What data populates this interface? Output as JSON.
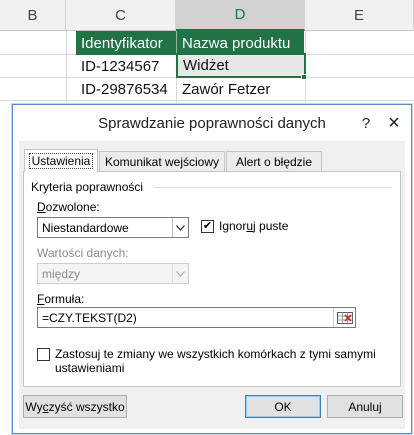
{
  "sheet": {
    "columns": [
      "B",
      "C",
      "D",
      "E"
    ],
    "selected_column": "D",
    "header_row": [
      "Identyfikator",
      "Nazwa produktu"
    ],
    "rows": [
      [
        "ID-1234567",
        "Widżet"
      ],
      [
        "ID-29876534",
        "Zawór Fetzer"
      ]
    ]
  },
  "dialog": {
    "title": "Sprawdzanie poprawności danych",
    "help_label": "?",
    "close_label": "×",
    "tabs": [
      "Ustawienia",
      "Komunikat wejściowy",
      "Alert o błędzie"
    ],
    "active_tab": "Ustawienia",
    "criteria_group": "Kryteria poprawności",
    "allow_label_pre": "",
    "allow_label_u": "D",
    "allow_label_post": "ozwolone:",
    "allow_value": "Niestandardowe",
    "ignore_blank_checked": "✔",
    "ignore_blank_pre": "Ignor",
    "ignore_blank_u": "u",
    "ignore_blank_post": "j puste",
    "data_label": "Wartości danych:",
    "data_value": "między",
    "formula_label_pre": "",
    "formula_label_u": "F",
    "formula_label_post": "ormuła:",
    "formula_value": "=CZY.TEKST(D2)",
    "apply_all_label": "Zastosuj te zmiany we wszystkich komórkach z tymi samymi ustawieniami",
    "clear_all_label_pre": "Wy",
    "clear_all_label_u": "c",
    "clear_all_label_post": "zyść wszystko",
    "ok_label": "OK",
    "cancel_label": "Anuluj"
  },
  "colors": {
    "excel_green": "#217346",
    "dialog_border": "#5c8ac8"
  }
}
